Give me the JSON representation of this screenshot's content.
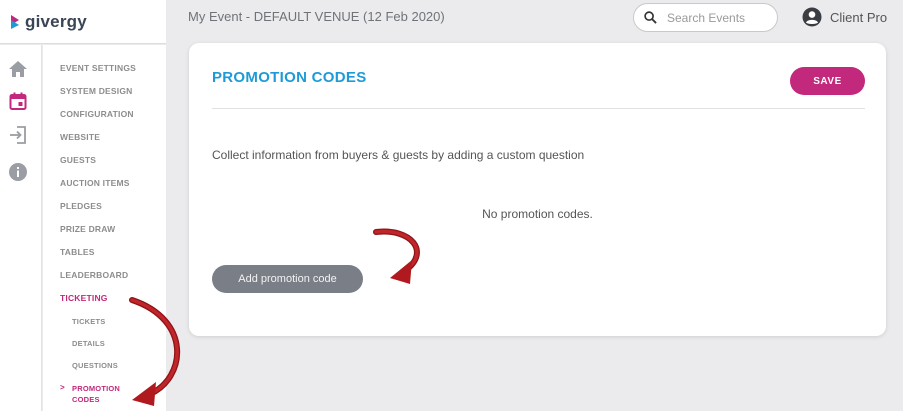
{
  "brand": {
    "logo_text": "givergy",
    "logo_color": "#c2287b"
  },
  "topbar": {
    "event_title": "My Event - DEFAULT VENUE (12 Feb 2020)",
    "search_placeholder": "Search Events",
    "search_icon": "search-icon",
    "user_icon": "user-circle-icon",
    "user_name": "Client Pro"
  },
  "rail": {
    "icons": [
      "home-icon",
      "calendar-icon",
      "login-icon",
      "info-icon"
    ],
    "active_color": "#c2287b"
  },
  "menu": {
    "items": [
      {
        "label": "EVENT SETTINGS"
      },
      {
        "label": "SYSTEM DESIGN"
      },
      {
        "label": "CONFIGURATION"
      },
      {
        "label": "WEBSITE"
      },
      {
        "label": "GUESTS"
      },
      {
        "label": "AUCTION ITEMS"
      },
      {
        "label": "PLEDGES"
      },
      {
        "label": "PRIZE DRAW"
      },
      {
        "label": "TABLES"
      },
      {
        "label": "LEADERBOARD"
      },
      {
        "label": "TICKETING"
      }
    ],
    "subitems": [
      {
        "label": "TICKETS"
      },
      {
        "label": "DETAILS"
      },
      {
        "label": "QUESTIONS"
      },
      {
        "label": "PROMOTION CODES",
        "chevron": ">"
      }
    ]
  },
  "card": {
    "title": "PROMOTION CODES",
    "save_label": "SAVE",
    "description": "Collect information from buyers & guests by adding a custom question",
    "empty_message": "No promotion codes.",
    "add_label": "Add promotion code"
  },
  "colors": {
    "accent": "#c2287b",
    "title_blue": "#1e9bd7",
    "annotation_red": "#b0191e",
    "button_gray": "#7a7e87"
  }
}
